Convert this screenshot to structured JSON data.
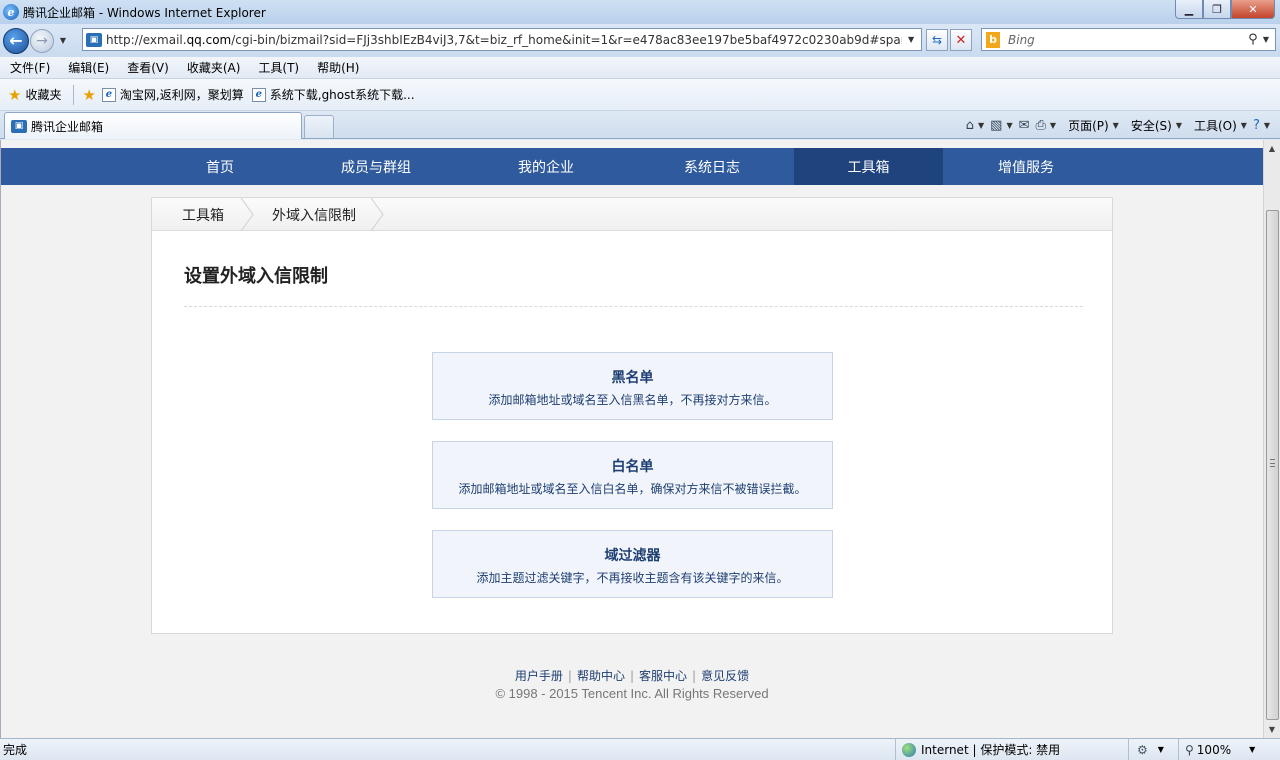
{
  "window": {
    "title": "腾讯企业邮箱 - Windows Internet Explorer"
  },
  "address": {
    "url_prefix": "http://exmail.",
    "url_domain": "qq.com",
    "url_suffix": "/cgi-bin/bizmail?sid=FJj3shbIEzB4viJ3,7&t=biz_rf_home&init=1&r=e478ac83ee197be5baf4972c0230ab9d#spam/outl",
    "search_placeholder": "Bing"
  },
  "menubar": [
    "文件(F)",
    "编辑(E)",
    "查看(V)",
    "收藏夹(A)",
    "工具(T)",
    "帮助(H)"
  ],
  "favorites": {
    "label": "收藏夹",
    "links": [
      "淘宝网,返利网，聚划算",
      "系统下载,ghost系统下载..."
    ]
  },
  "tab": {
    "title": "腾讯企业邮箱"
  },
  "commandbar": {
    "page": "页面(P)",
    "safety": "安全(S)",
    "tools": "工具(O)"
  },
  "site_nav": {
    "items": [
      "首页",
      "成员与群组",
      "我的企业",
      "系统日志",
      "工具箱",
      "增值服务"
    ],
    "active": "工具箱"
  },
  "breadcrumb": [
    "工具箱",
    "外域入信限制"
  ],
  "page_title": "设置外域入信限制",
  "options": [
    {
      "title": "黑名单",
      "desc": "添加邮箱地址或域名至入信黑名单，不再接对方来信。"
    },
    {
      "title": "白名单",
      "desc": "添加邮箱地址或域名至入信白名单，确保对方来信不被错误拦截。"
    },
    {
      "title": "域过滤器",
      "desc": "添加主题过滤关键字，不再接收主题含有该关键字的来信。"
    }
  ],
  "footer": {
    "links": [
      "用户手册",
      "帮助中心",
      "客服中心",
      "意见反馈"
    ],
    "copyright": "© 1998 - 2015 Tencent Inc. All Rights Reserved"
  },
  "statusbar": {
    "status": "完成",
    "zone": "Internet | 保护模式: 禁用",
    "zoom": "100%"
  }
}
